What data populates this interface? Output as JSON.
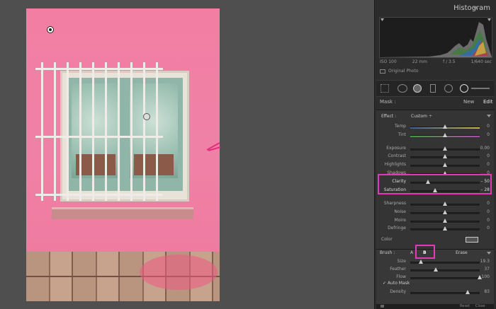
{
  "panel": {
    "title": "Histogram",
    "histogram_info": {
      "iso": "ISO 100",
      "focal": "22 mm",
      "aperture": "f / 3.5",
      "shutter": "1/640 sec"
    },
    "original_photo": "Original Photo",
    "mask": {
      "label": "Mask :",
      "new": "New",
      "edit": "Edit"
    },
    "effect": {
      "label": "Effect :",
      "value": "Custom ÷"
    },
    "sliders": [
      {
        "label": "Temp",
        "value": "0",
        "pos": 0.5
      },
      {
        "label": "Tint",
        "value": "0",
        "pos": 0.5
      },
      {
        "label": "Exposure",
        "value": "0.00",
        "pos": 0.5
      },
      {
        "label": "Contrast",
        "value": "0",
        "pos": 0.5
      },
      {
        "label": "Highlights",
        "value": "0",
        "pos": 0.5
      },
      {
        "label": "Shadows",
        "value": "0",
        "pos": 0.5
      },
      {
        "label": "Clarity",
        "value": "– 50",
        "pos": 0.25
      },
      {
        "label": "Saturation",
        "value": "– 28",
        "pos": 0.36
      },
      {
        "label": "Sharpness",
        "value": "0",
        "pos": 0.5
      },
      {
        "label": "Noise",
        "value": "0",
        "pos": 0.5
      },
      {
        "label": "Moire",
        "value": "0",
        "pos": 0.5
      },
      {
        "label": "Defringe",
        "value": "0",
        "pos": 0.5
      }
    ],
    "color_label": "Color",
    "brush": {
      "label": "Brush :",
      "a": "A",
      "b": "B",
      "erase": "Erase",
      "size_label": "Size",
      "size_value": "19.3",
      "size_pos": 0.15,
      "feather_label": "Feather",
      "feather_value": "37",
      "feather_pos": 0.37,
      "flow_label": "Flow",
      "flow_value": "100",
      "flow_pos": 1.0,
      "automask_label": "Auto Mask",
      "density_label": "Density",
      "density_value": "83",
      "density_pos": 0.83
    },
    "bottom": {
      "reset": "Reset",
      "close": "Close"
    }
  },
  "colors": {
    "highlight": "#e43ab9",
    "wall_pink": "#f27ea4"
  }
}
